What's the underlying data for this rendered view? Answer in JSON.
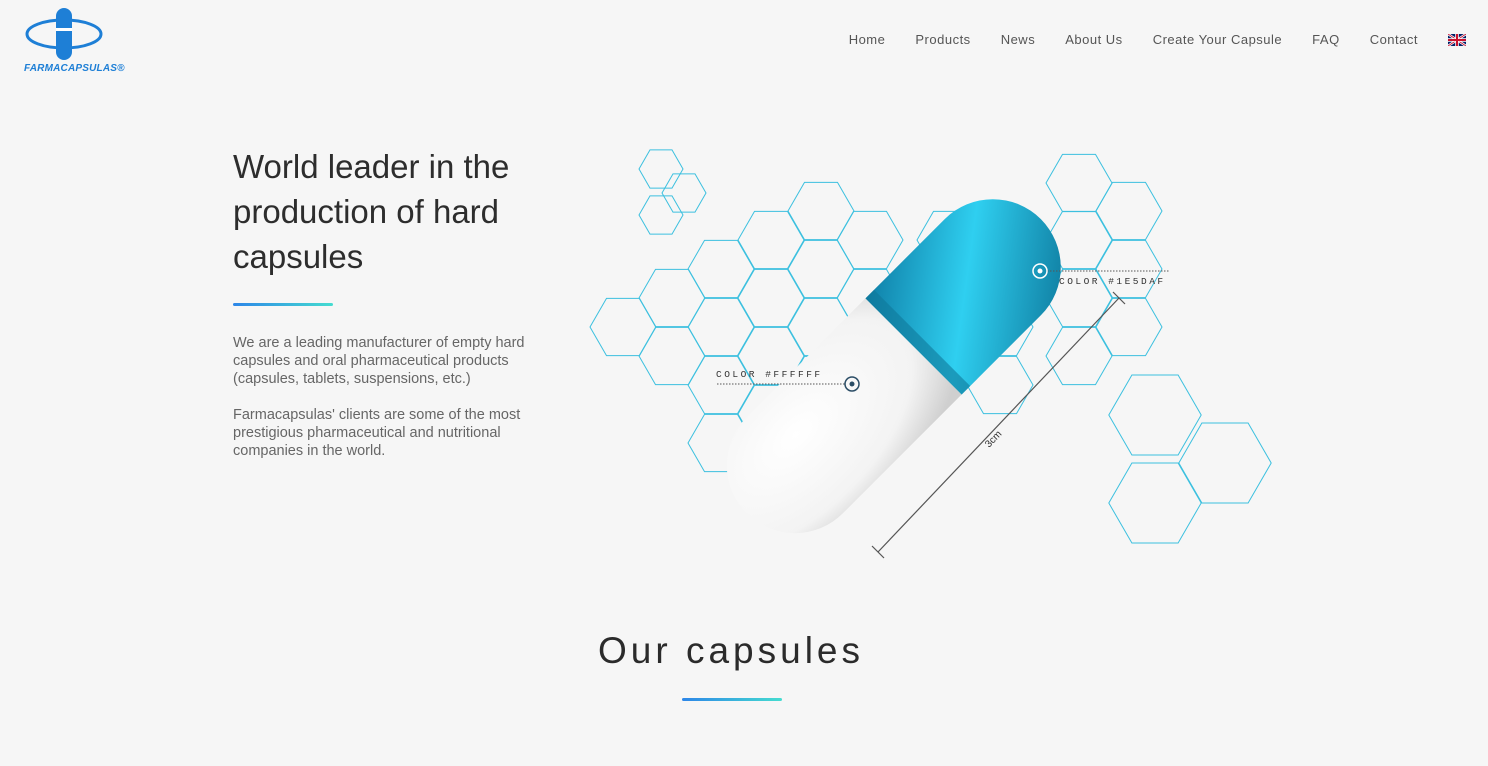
{
  "brand": {
    "logo_text": "FARMACAPSULAS®",
    "primary_color": "#1e7fd6"
  },
  "nav": {
    "items": [
      {
        "label": "Home",
        "name": "nav-home"
      },
      {
        "label": "Products",
        "name": "nav-products"
      },
      {
        "label": "News",
        "name": "nav-news"
      },
      {
        "label": "About Us",
        "name": "nav-about-us"
      },
      {
        "label": "Create Your Capsule",
        "name": "nav-create-your-capsule"
      },
      {
        "label": "FAQ",
        "name": "nav-faq"
      },
      {
        "label": "Contact",
        "name": "nav-contact"
      }
    ],
    "language_icon": "uk-flag-icon"
  },
  "hero": {
    "title_lines": [
      "World leader in the",
      "production of hard",
      "capsules"
    ],
    "paragraph1_lines": [
      "We are a leading manufacturer of empty hard",
      "capsules and oral pharmaceutical products",
      "(capsules, tablets, suspensions, etc.)"
    ],
    "paragraph2_lines": [
      "Farmacapsulas' clients are some of the most",
      "prestigious pharmaceutical and nutritional",
      "companies in the world."
    ],
    "accent_gradient": [
      "#2d86e8",
      "#45dcd0"
    ]
  },
  "illustration": {
    "label_body": "COLOR #FFFFFF",
    "label_cap": "COLOR #1E5DAF",
    "dimension_label": "3cm",
    "cap_color": "#1aa0c6",
    "body_color": "#ffffff",
    "hex_stroke": "#3cc0df"
  },
  "section": {
    "title": "Our capsules"
  }
}
